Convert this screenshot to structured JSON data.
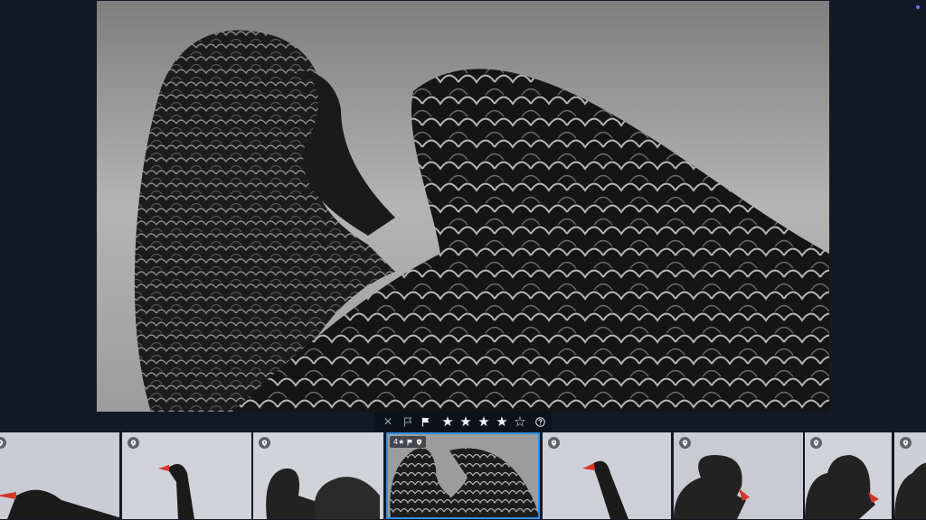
{
  "toolbar": {
    "reject_icon": "close-icon",
    "reject_label": "✕",
    "unflag_icon": "flag-outline-icon",
    "pick_icon": "flag-filled-icon",
    "rating": 4,
    "max_rating": 5,
    "star_filled": "★",
    "star_empty": "☆",
    "help_icon": "help-circle-icon"
  },
  "filmstrip": {
    "selected_index": 3,
    "selected_rating_label": "4★",
    "thumbnails": [
      {
        "badge_icon": "location-pin-icon"
      },
      {
        "badge_icon": "location-pin-icon"
      },
      {
        "badge_icon": "location-pin-icon"
      },
      {
        "badge_icon": "location-pin-icon",
        "selected": true
      },
      {
        "badge_icon": "location-pin-icon"
      },
      {
        "badge_icon": "location-pin-icon"
      },
      {
        "badge_icon": "location-pin-icon"
      },
      {
        "badge_icon": "location-pin-icon"
      }
    ]
  },
  "colors": {
    "background": "#131824",
    "toolbar_bg": "#0d111a",
    "selection": "#2f8fe0",
    "accent_dot": "#7b6cf5",
    "swan_beak": "#d8342c"
  }
}
